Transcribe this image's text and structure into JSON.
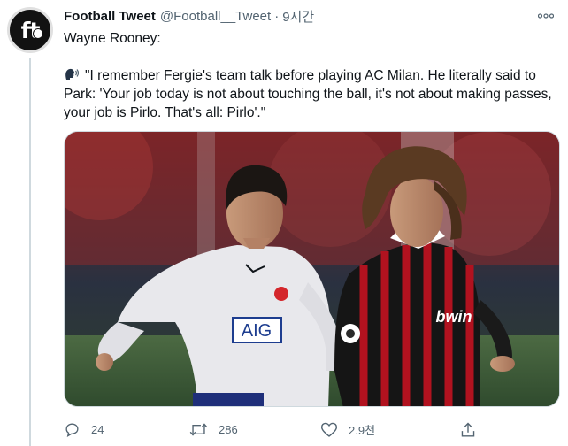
{
  "tweet": {
    "author_name": "Football Tweet",
    "author_handle": "@Football__Tweet",
    "separator": "·",
    "timestamp": "9시간",
    "avatar_text": "ft",
    "line1": "Wayne Rooney:",
    "quote": "\"I remember Fergie's team talk before playing AC Milan. He literally said to Park: 'Your job today is not about touching the ball, it's not about making passes, your job is Pirlo. That's all: Pirlo'.\"",
    "image": {
      "shirt_sponsor_left": "AIG",
      "shirt_sponsor_right": "bwin"
    }
  },
  "actions": {
    "reply_count": "24",
    "retweet_count": "286",
    "like_count": "2.9천"
  },
  "colors": {
    "text_primary": "#0f1419",
    "text_secondary": "#536471",
    "border": "#cfd9de",
    "milan_red": "#c8102e"
  }
}
